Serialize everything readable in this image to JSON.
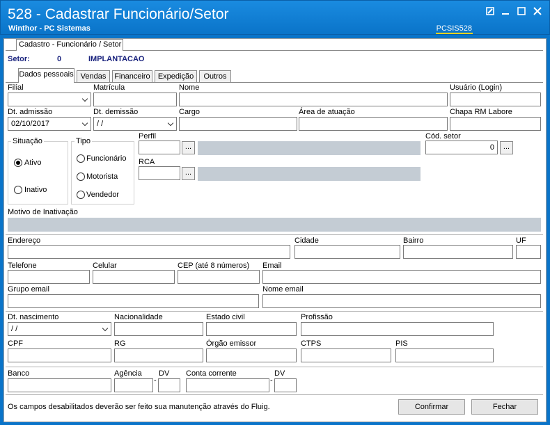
{
  "window": {
    "title": "528 - Cadastrar Funcionário/Setor",
    "subtitle": "Winthor - PC Sistemas",
    "code": "PCSIS528"
  },
  "top_tab": "Cadastro - Funcionário / Setor",
  "setor": {
    "label": "Setor:",
    "number": "0",
    "name": "IMPLANTACAO"
  },
  "tabs": [
    "Dados pessoais",
    "Vendas",
    "Financeiro",
    "Expedição",
    "Outros"
  ],
  "labels": {
    "filial": "Filial",
    "matricula": "Matrícula",
    "nome": "Nome",
    "usuario": "Usuário (Login)",
    "dt_admissao": "Dt. admissão",
    "dt_demissao": "Dt.  demissão",
    "cargo": "Cargo",
    "area_atuacao": "Área de atuação",
    "chapa_rm": "Chapa RM Labore",
    "situacao": "Situação",
    "tipo": "Tipo",
    "perfil": "Perfil",
    "rca": "RCA",
    "cod_setor": "Cód. setor",
    "motivo_inativacao": "Motivo de Inativação",
    "endereco": "Endereço",
    "cidade": "Cidade",
    "bairro": "Bairro",
    "uf": "UF",
    "telefone": "Telefone",
    "celular": "Celular",
    "cep": "CEP (até 8 números)",
    "email": "Email",
    "grupo_email": "Grupo email",
    "nome_email": "Nome email",
    "dt_nascimento": "Dt. nascimento",
    "nacionalidade": "Nacionalidade",
    "estado_civil": "Estado civil",
    "profissao": "Profissão",
    "cpf": "CPF",
    "rg": "RG",
    "orgao_emissor": "Órgão emissor",
    "ctps": "CTPS",
    "pis": "PIS",
    "banco": "Banco",
    "agencia": "Agência",
    "dv": "DV",
    "conta_corrente": "Conta corrente"
  },
  "values": {
    "dt_admissao": "02/10/2017",
    "dt_demissao": " / /",
    "dt_nascimento": " / /",
    "cod_setor": "0",
    "agencia_sep": "-",
    "conta_sep": "-"
  },
  "situacao": {
    "options": [
      "Ativo",
      "Inativo"
    ],
    "selected": "Ativo"
  },
  "tipo": {
    "options": [
      "Funcionário",
      "Motorista",
      "Vendedor"
    ]
  },
  "ellipsis": "...",
  "footer_text": "Os campos desabilitados deverão ser feito sua manutenção através do Fluig.",
  "buttons": {
    "confirmar": "Confirmar",
    "fechar": "Fechar"
  },
  "colors": {
    "titlebar": "#0a74c9",
    "accent_underline": "#ffd21e",
    "disabled_field": "#c4ccd4",
    "setor_text": "#1a237e"
  }
}
